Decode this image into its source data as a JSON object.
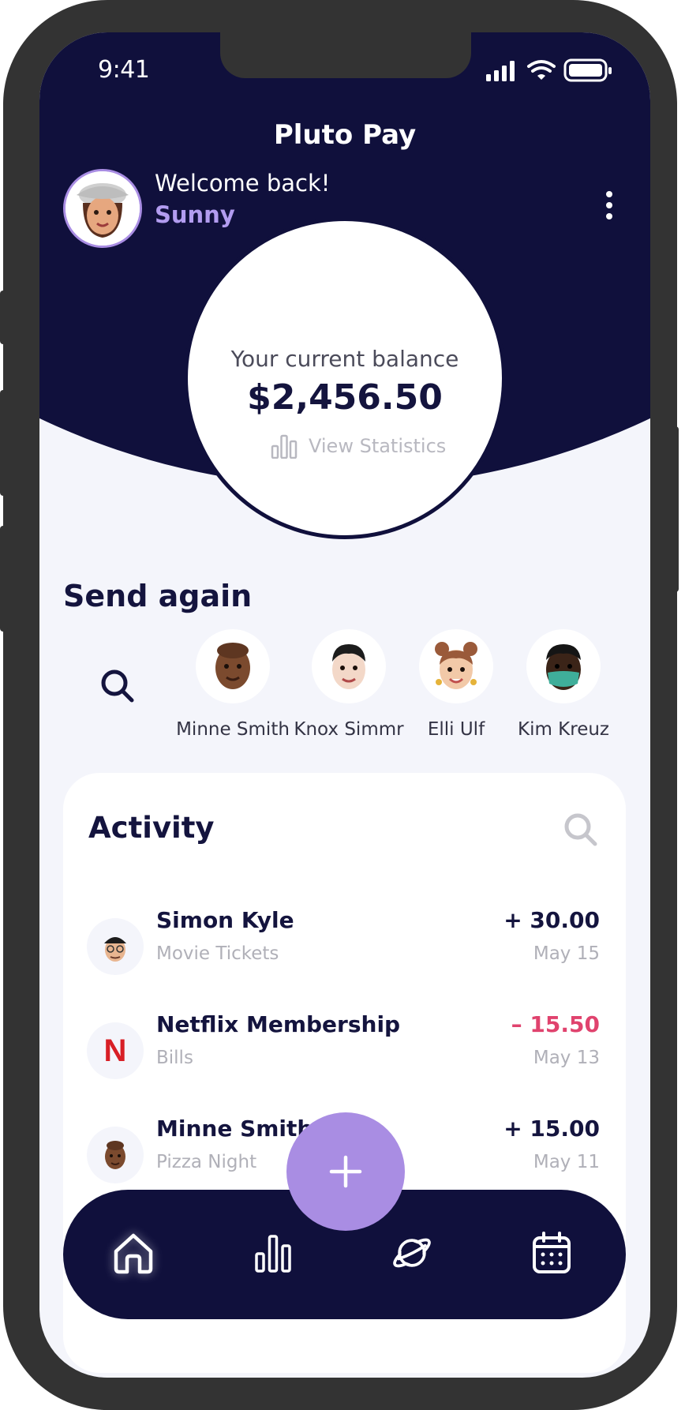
{
  "status_bar": {
    "time": "9:41"
  },
  "app": {
    "title": "Pluto Pay"
  },
  "user": {
    "greeting": "Welcome back!",
    "name": "Sunny"
  },
  "balance": {
    "label": "Your current balance",
    "amount": "$2,456.50",
    "stats_link": "View Statistics"
  },
  "send_again": {
    "title": "Send again",
    "contacts": [
      {
        "name": "Minne Smith",
        "skin": "#7b4a2e"
      },
      {
        "name": "Knox Simmr",
        "skin": "#f3d8c8"
      },
      {
        "name": "Elli Ulf",
        "skin": "#f2c9a8"
      },
      {
        "name": "Kim Kreuz",
        "skin": "#3b2418"
      }
    ]
  },
  "activity": {
    "title": "Activity",
    "transactions": [
      {
        "name": "Simon Kyle",
        "category": "Movie Tickets",
        "amount": "+ 30.00",
        "date": "May 15",
        "type": "credit"
      },
      {
        "name": "Netflix Membership",
        "category": "Bills",
        "amount": "– 15.50",
        "date": "May 13",
        "type": "debit",
        "logo_letter": "N"
      },
      {
        "name": "Minne Smith",
        "category": "Pizza Night",
        "amount": "+ 15.00",
        "date": "May 11",
        "type": "credit"
      }
    ]
  },
  "colors": {
    "navy": "#10103c",
    "lavender": "#a98de3",
    "negative": "#e0436e",
    "background": "#f4f5fb"
  },
  "nav": [
    {
      "icon": "home-icon",
      "active": true
    },
    {
      "icon": "bar-chart-icon"
    },
    {
      "icon": "planet-icon"
    },
    {
      "icon": "calendar-icon"
    }
  ],
  "fab": {
    "icon": "plus-icon"
  }
}
